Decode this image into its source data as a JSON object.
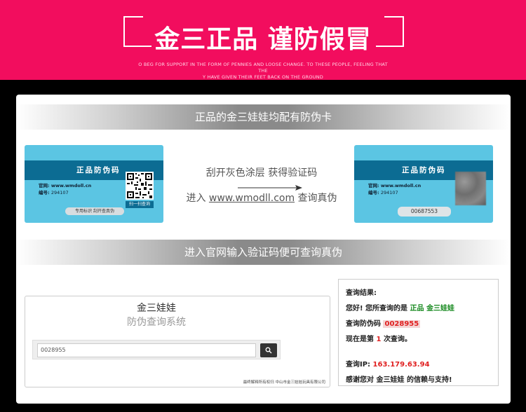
{
  "header": {
    "title": "金三正品 谨防假冒",
    "subtitle_line1": "O BEG FOR SUPPORT IN THE FORM OF PENNIES AND LOOSE CHANGE. TO THESE PEOPLE, FEELING THAT THE",
    "subtitle_line2": "Y HAVE GIVEN THEIR FEET BACK ON THE GROUND"
  },
  "band1": "正品的金三娃娃均配有防伪卡",
  "band2": "进入官网输入验证码便可查询真伪",
  "card_front": {
    "title": "正品防伪码",
    "site_label": "官网: www.wmdoll.cn",
    "number_label": "编号:",
    "number_value": "294107",
    "pill": "专用标识 刮开查真伪",
    "qr_label": "扫一扫查询"
  },
  "card_back": {
    "title": "正品防伪码",
    "site_label": "官网: www.wmdoll.cn",
    "number_label": "编号:",
    "number_value": "294107",
    "code": "00687553"
  },
  "middle": {
    "line1": "刮开灰色涂层  获得验证码",
    "line2_pre": "进入 ",
    "line2_url": "www.wmodll.com",
    "line2_post": " 查询真伪"
  },
  "search_box": {
    "title": "金三娃娃",
    "subtitle": "防伪查询系统",
    "input_value": "0028955",
    "footer": "最终解释所有权归 中山市金三娃娃玩具有限公司"
  },
  "result": {
    "heading": "查询结果:",
    "line1_pre": "您好! 您所查询的是",
    "line1_brand": "正品 金三娃娃",
    "line2_label": "查询防伪码",
    "line2_code": "0028955",
    "line3_pre": "现在是第",
    "line3_count": "1",
    "line3_post": "次查询。",
    "ip_label": "查询IP:",
    "ip_value": "163.179.63.94",
    "thanks": "感谢您对 金三娃娃 的信赖与支持!"
  }
}
